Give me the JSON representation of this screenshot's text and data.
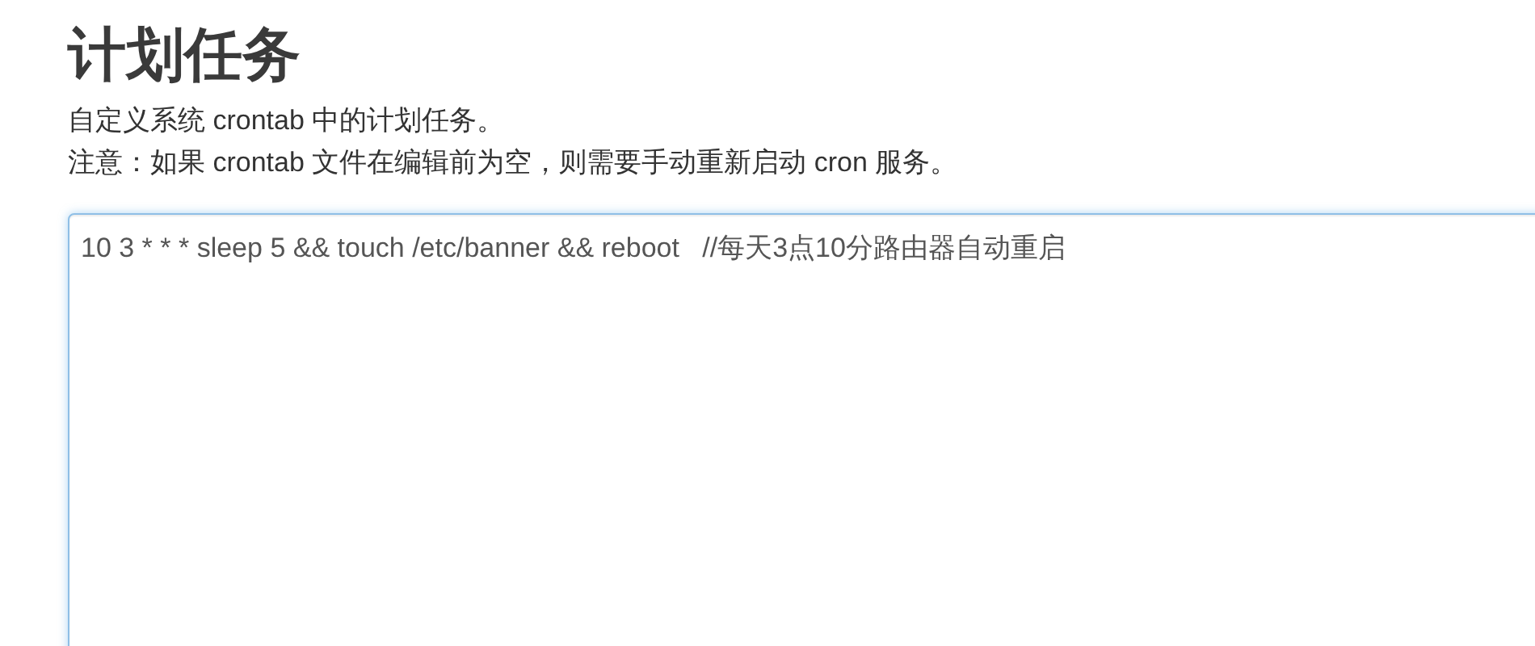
{
  "page": {
    "title": "计划任务",
    "description": [
      "自定义系统 crontab 中的计划任务。",
      "注意：如果 crontab 文件在编辑前为空，则需要手动重新启动 cron 服务。"
    ]
  },
  "crontab_editor": {
    "value": "10 3 * * * sleep 5 && touch /etc/banner && reboot   //每天3点10分路由器自动重启"
  }
}
